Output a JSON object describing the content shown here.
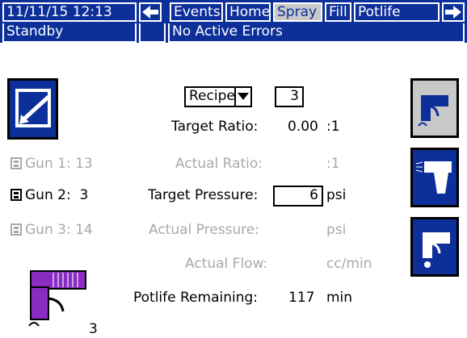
{
  "header": {
    "datetime": "11/11/15 12:13",
    "nav_left": "←",
    "tabs": [
      {
        "label": "Events",
        "active": false
      },
      {
        "label": "Home",
        "active": false
      },
      {
        "label": "Spray",
        "active": true
      },
      {
        "label": "Fill",
        "active": false
      },
      {
        "label": "Potlife",
        "active": false
      }
    ],
    "nav_right": "→"
  },
  "status": {
    "mode": "Standby",
    "errors": "No Active Errors"
  },
  "recipe": {
    "label": "Recipe",
    "value": "3"
  },
  "guns": [
    {
      "label": "Gun 1: 13",
      "enabled": false
    },
    {
      "label": "Gun 2:  3",
      "enabled": true
    },
    {
      "label": "Gun 3: 14",
      "enabled": false
    }
  ],
  "fields": {
    "target_ratio_label": "Target Ratio:",
    "target_ratio_value": "0.00",
    "target_ratio_unit": ":1",
    "actual_ratio_label": "Actual Ratio:",
    "actual_ratio_unit": ":1",
    "target_pressure_label": "Target Pressure:",
    "target_pressure_value": "6",
    "target_pressure_unit": "psi",
    "actual_pressure_label": "Actual Pressure:",
    "actual_pressure_unit": "psi",
    "actual_flow_label": "Actual Flow:",
    "actual_flow_unit": "cc/min",
    "potlife_label": "Potlife Remaining:",
    "potlife_value": "117",
    "potlife_unit": "min"
  },
  "gun_display_number": "3",
  "colors": {
    "header_blue": "#0d2f9a",
    "active_tab": "#c8c8c8",
    "disabled_text": "#a8a8a8",
    "gun_purple": "#8a2bc2"
  }
}
